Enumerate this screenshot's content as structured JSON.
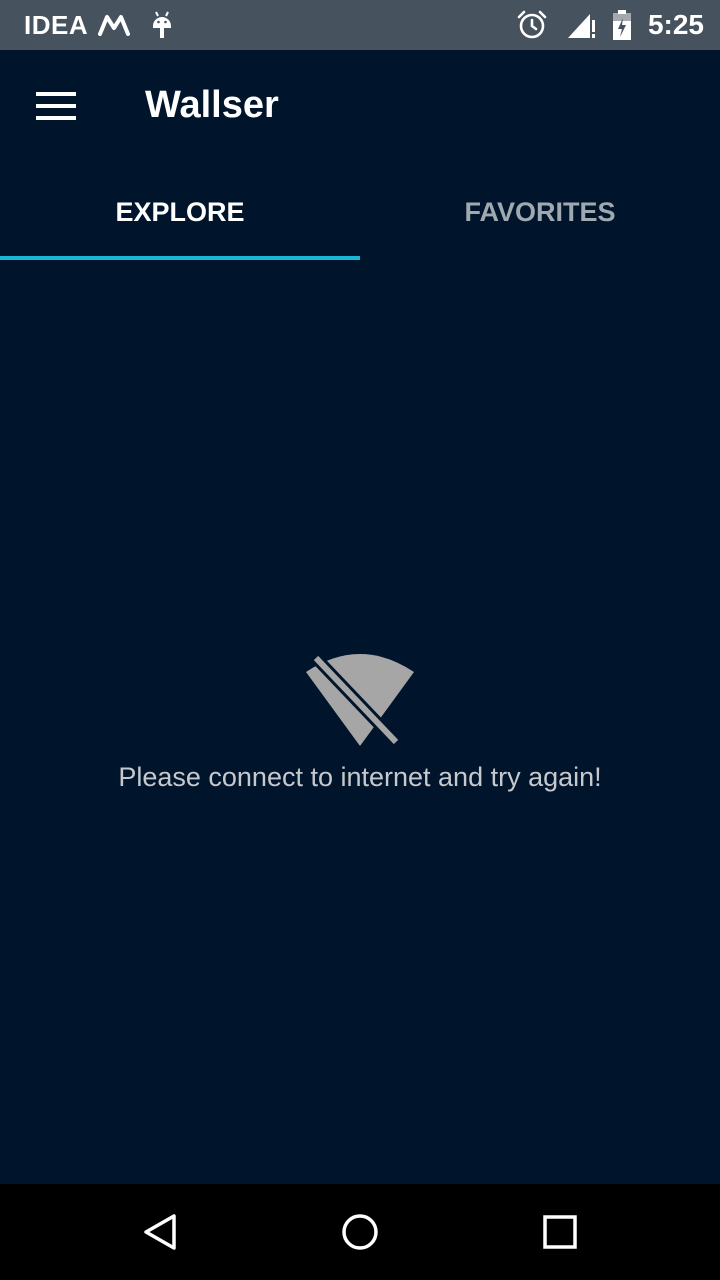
{
  "status_bar": {
    "carrier": "IDEA",
    "time": "5:25",
    "icons": [
      "motorola-icon",
      "android-notification-icon",
      "alarm-icon",
      "signal-icon",
      "battery-icon"
    ]
  },
  "app_bar": {
    "title": "Wallser",
    "menu_icon": "hamburger-menu-icon"
  },
  "tabs": [
    {
      "label": "EXPLORE",
      "active": true
    },
    {
      "label": "FAVORITES",
      "active": false
    }
  ],
  "empty_state": {
    "icon": "wifi-off-icon",
    "message": "Please connect to internet and try again!"
  },
  "nav_bar": {
    "icons": [
      "back-icon",
      "home-icon",
      "recents-icon"
    ]
  },
  "colors": {
    "background": "#00152b",
    "status_bar": "#46525e",
    "accent": "#1ab6d6",
    "nav_bar": "#000000"
  }
}
